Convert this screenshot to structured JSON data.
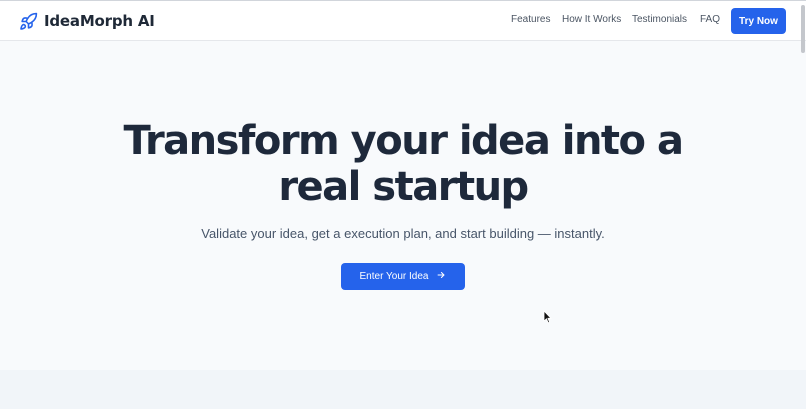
{
  "brand": {
    "name": "IdeaMorph AI",
    "icon": "rocket-icon"
  },
  "nav": {
    "items": [
      "Features",
      "How It Works",
      "Testimonials",
      "FAQ"
    ],
    "cta_label": "Try Now"
  },
  "hero": {
    "title_line1": "Transform your idea into a",
    "title_line2": "real startup",
    "subtitle": "Validate your idea, get a execution plan, and start building — instantly.",
    "button_label": "Enter Your Idea",
    "button_icon": "arrow-right-icon"
  },
  "colors": {
    "accent": "#2563eb",
    "heading": "#1e293b",
    "page_bg": "#f8fafc"
  }
}
